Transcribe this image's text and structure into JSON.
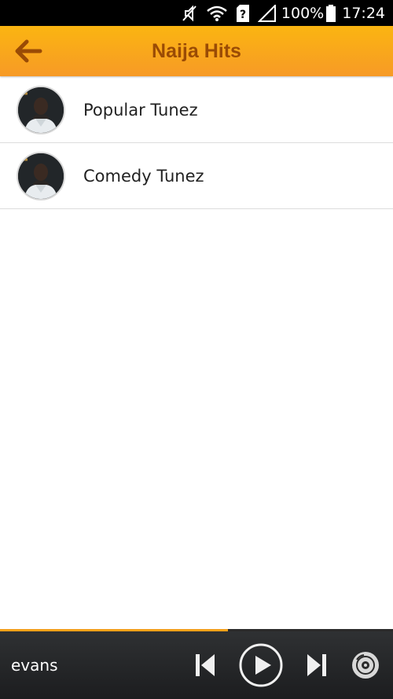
{
  "status_bar": {
    "battery_text": "100%",
    "time": "17:24",
    "icons": [
      "mute-icon",
      "wifi-icon",
      "sim-unknown-icon",
      "signal-icon",
      "battery-icon"
    ]
  },
  "app_bar": {
    "title": "Naija Hits",
    "back_icon": "arrow-left-icon",
    "background": "#fbb511",
    "title_color": "#9a4b05"
  },
  "list": {
    "items": [
      {
        "label": "Popular Tunez",
        "avatar": "artist-avatar"
      },
      {
        "label": "Comedy Tunez",
        "avatar": "artist-avatar"
      }
    ]
  },
  "player": {
    "track": "evans",
    "progress": 0.58,
    "accent": "#f7a11a",
    "controls": [
      "previous-icon",
      "play-icon",
      "next-icon",
      "disc-icon"
    ]
  }
}
